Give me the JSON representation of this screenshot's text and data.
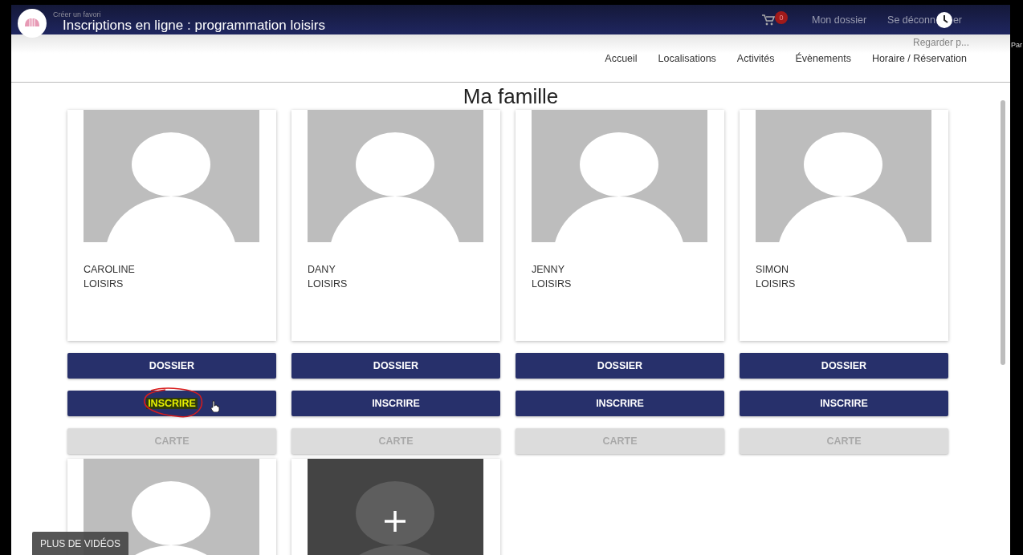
{
  "video_overlay": {
    "bookmark_hint": "Créer un favori",
    "title": "Inscriptions en ligne : programmation loisirs",
    "watch_later": "Regarder p...",
    "share_cut": "Par",
    "more_videos": "PLUS DE VIDÉOS"
  },
  "top_bar": {
    "cart_count": "0",
    "account": "Mon dossier",
    "logout_parts": [
      "Se déconn",
      "er"
    ]
  },
  "nav": [
    {
      "label": "Accueil"
    },
    {
      "label": "Localisations"
    },
    {
      "label": "Activités"
    },
    {
      "label": "Évènements"
    },
    {
      "label": "Horaire / Réservation"
    }
  ],
  "heading": "Ma famille",
  "members": [
    {
      "first_name": "CAROLINE",
      "last_name": "LOISIRS",
      "buttons": [
        {
          "label": "DOSSIER",
          "kind": "primary",
          "highlighted": false
        },
        {
          "label": "INSCRIRE",
          "kind": "primary",
          "highlighted": true
        },
        {
          "label": "CARTE",
          "kind": "disabled",
          "highlighted": false
        }
      ]
    },
    {
      "first_name": "DANY",
      "last_name": "LOISIRS",
      "buttons": [
        {
          "label": "DOSSIER",
          "kind": "primary",
          "highlighted": false
        },
        {
          "label": "INSCRIRE",
          "kind": "primary",
          "highlighted": false
        },
        {
          "label": "CARTE",
          "kind": "disabled",
          "highlighted": false
        }
      ]
    },
    {
      "first_name": "JENNY",
      "last_name": "LOISIRS",
      "buttons": [
        {
          "label": "DOSSIER",
          "kind": "primary",
          "highlighted": false
        },
        {
          "label": "INSCRIRE",
          "kind": "primary",
          "highlighted": false
        },
        {
          "label": "CARTE",
          "kind": "disabled",
          "highlighted": false
        }
      ]
    },
    {
      "first_name": "SIMON",
      "last_name": "LOISIRS",
      "buttons": [
        {
          "label": "DOSSIER",
          "kind": "primary",
          "highlighted": false
        },
        {
          "label": "INSCRIRE",
          "kind": "primary",
          "highlighted": false
        },
        {
          "label": "CARTE",
          "kind": "disabled",
          "highlighted": false
        }
      ]
    }
  ],
  "more_cards": [
    {
      "kind": "member"
    },
    {
      "kind": "add"
    }
  ]
}
